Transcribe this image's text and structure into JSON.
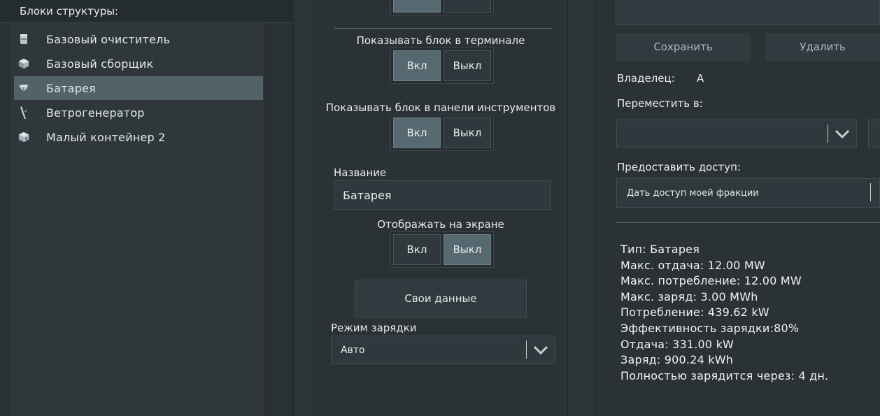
{
  "left": {
    "header": "Блоки структуры:",
    "items": [
      {
        "label": "Базовый очиститель",
        "icon": "cylinder-block-icon"
      },
      {
        "label": "Базовый сборщик",
        "icon": "cube-block-icon"
      },
      {
        "label": "Батарея",
        "icon": "battery-block-icon",
        "selected": true
      },
      {
        "label": "Ветрогенератор",
        "icon": "wind-turbine-icon"
      },
      {
        "label": "Малый контейнер 2",
        "icon": "container-block-icon"
      }
    ]
  },
  "middle": {
    "show_in_terminal": {
      "label": "Показывать блок в терминале",
      "on": "Вкл",
      "off": "Выкл",
      "value": "on"
    },
    "show_in_toolbar": {
      "label": "Показывать блок в панели инструментов",
      "on": "Вкл",
      "off": "Выкл",
      "value": "on"
    },
    "name": {
      "label": "Название",
      "value": "Батарея"
    },
    "show_on_screen": {
      "label": "Отображать на экране",
      "on": "Вкл",
      "off": "Выкл",
      "value": "off"
    },
    "custom_data_button": "Свои данные",
    "charge_mode": {
      "label": "Режим зарядки",
      "value": "Авто"
    }
  },
  "right": {
    "save_button": "Сохранить",
    "delete_button": "Удалить",
    "owner_label": "Владелец:",
    "owner_value": "А",
    "move_to_label": "Переместить в:",
    "move_to_value": "",
    "share_label": "Предоставить доступ:",
    "share_value": "Дать доступ моей фракции",
    "info": [
      "Тип: Батарея",
      "Макс. отдача: 12.00 MW",
      "Макс. потребление: 12.00 MW",
      "Макс. заряд: 3.00 MWh",
      "Потребление: 439.62 kW",
      "Эффективность зарядки:80%",
      "Отдача: 331.00 kW",
      "Заряд: 900.24 kWh",
      "Полностью зарядится через: 4 дн."
    ]
  },
  "colors": {
    "background": "#2b3236",
    "selected": "#536168",
    "toggle_on": "#566870",
    "text": "#e6ebee"
  }
}
